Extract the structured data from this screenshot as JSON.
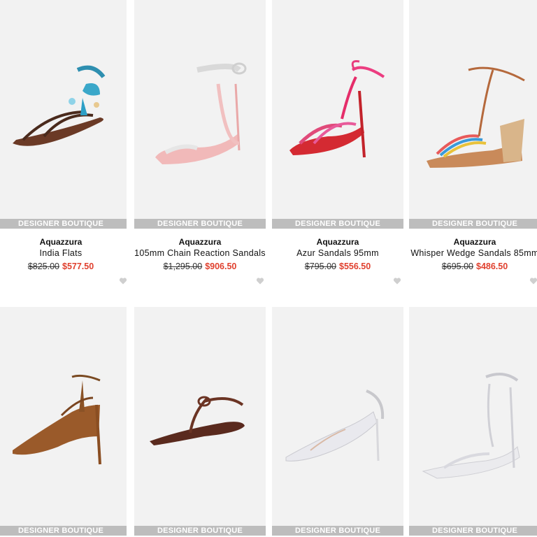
{
  "badge_text": "DESIGNER BOUTIQUE",
  "colors": {
    "sale": "#e0402e",
    "badge_bg": "#bdbdbd",
    "image_bg": "#f2f2f2"
  },
  "products": [
    {
      "brand": "Aquazzura",
      "name": "India Flats",
      "original_price": "$825.00",
      "sale_price": "$577.50",
      "image": "brown-flat-sandal-with-beaded-tassels"
    },
    {
      "brand": "Aquazzura",
      "name": "105mm Chain Reaction Sandals",
      "original_price": "$1,295.00",
      "sale_price": "$906.50",
      "image": "pink-crystal-chain-heel-sandal"
    },
    {
      "brand": "Aquazzura",
      "name": "Azur Sandals 95mm",
      "original_price": "$795.00",
      "sale_price": "$556.50",
      "image": "red-pink-strappy-lace-up-sandal"
    },
    {
      "brand": "Aquazzura",
      "name": "Whisper Wedge Sandals 85mm",
      "original_price": "$695.00",
      "sale_price": "$486.50",
      "image": "rainbow-strap-cork-wedge-sandal"
    },
    {
      "image": "brown-suede-lace-up-pump"
    },
    {
      "image": "brown-thong-flat-sandal"
    },
    {
      "image": "clear-pvc-silver-slingback-pump"
    },
    {
      "image": "clear-crystal-ankle-strap-sandal"
    }
  ]
}
